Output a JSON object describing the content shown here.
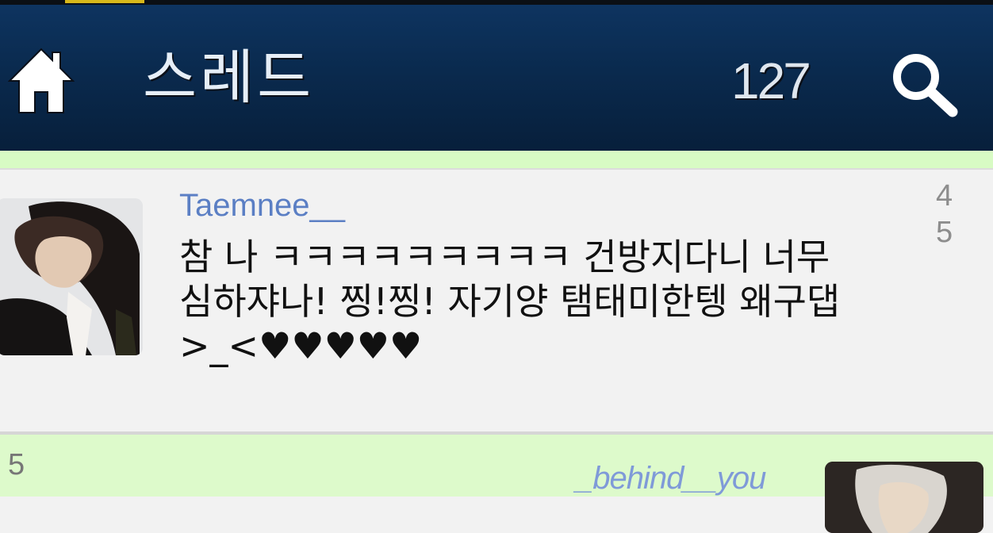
{
  "header": {
    "title": "스레드",
    "count": "127",
    "home_icon": "home-icon",
    "search_icon": "search-icon",
    "bar_color": "#0a2a4e"
  },
  "tweets": [
    {
      "username": "Taemnee__",
      "time": "4 5",
      "text": "참 나 ㅋㅋㅋㅋㅋㅋㅋㅋㅋ 건방지다니 너무\n심하쟈나! 찡!찡! 자기양 탬태미한텡 왜구댑\n>_<♥♥♥♥♥",
      "avatar": "avatar-image"
    },
    {
      "username": "_behind__you",
      "time": "5",
      "avatar": "avatar-image"
    }
  ],
  "colors": {
    "username": "#5b7fc4",
    "separator_green": "#d8fbc4",
    "card_bg": "#f2f2f2"
  }
}
